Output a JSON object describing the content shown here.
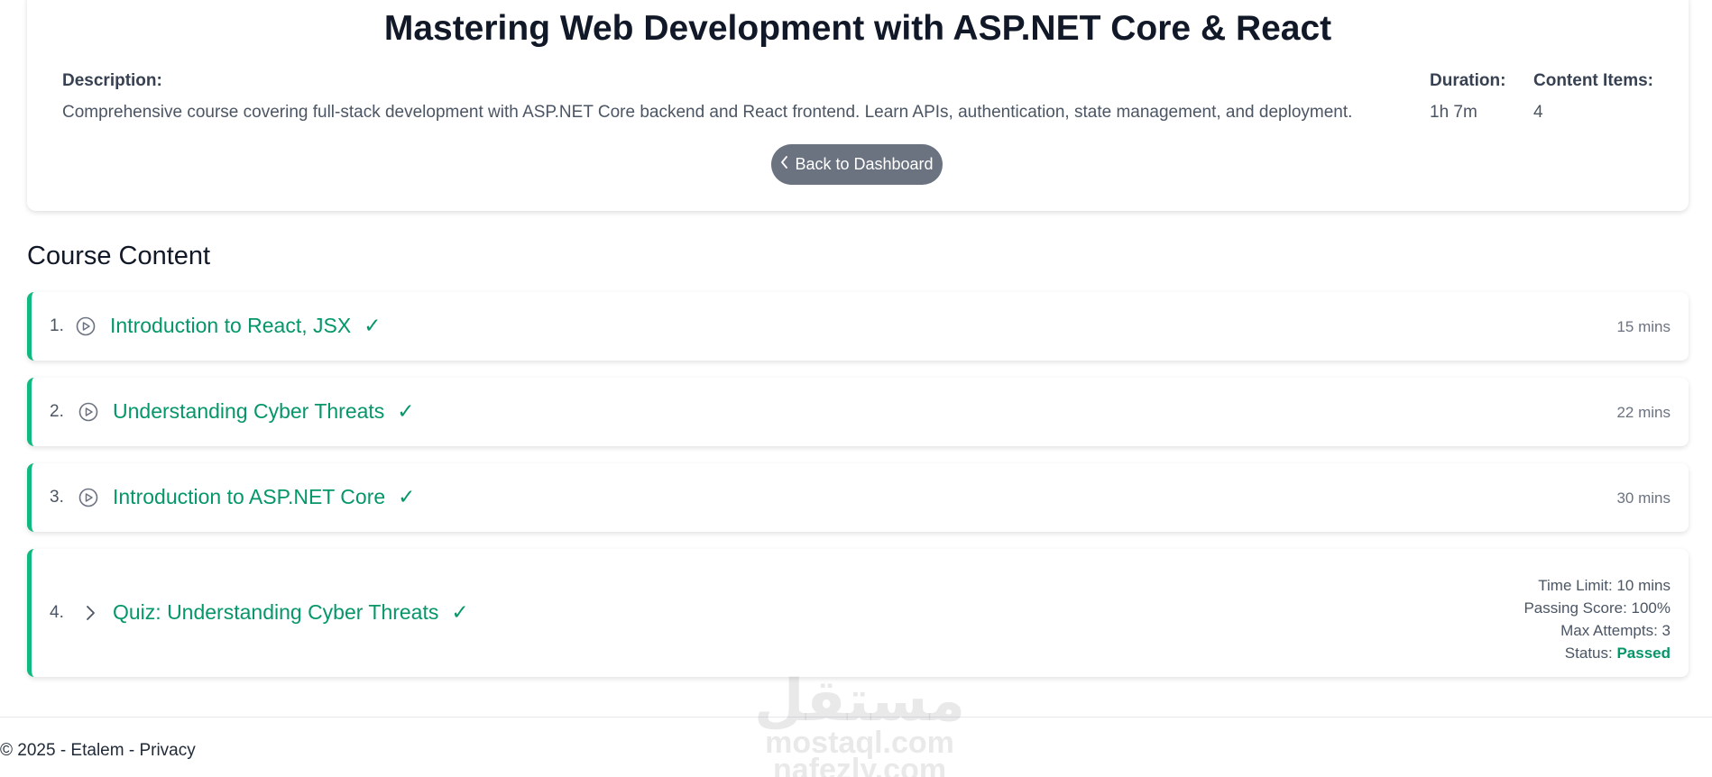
{
  "course": {
    "title": "Mastering Web Development with ASP.NET Core & React",
    "description_label": "Description:",
    "description": "Comprehensive course covering full-stack development with ASP.NET Core backend and React frontend. Learn APIs, authentication, state management, and deployment.",
    "duration_label": "Duration:",
    "duration": "1h 7m",
    "content_items_label": "Content Items:",
    "content_items": "4",
    "back_button": "Back to Dashboard"
  },
  "content": {
    "heading": "Course Content",
    "items": [
      {
        "number": "1.",
        "icon": "play-circle-icon",
        "title": "Introduction to React, JSX",
        "check": "✓",
        "duration": "15 mins"
      },
      {
        "number": "2.",
        "icon": "play-circle-icon",
        "title": "Understanding Cyber Threats",
        "check": "✓",
        "duration": "22 mins"
      },
      {
        "number": "3.",
        "icon": "play-circle-icon",
        "title": "Introduction to ASP.NET Core",
        "check": "✓",
        "duration": "30 mins"
      },
      {
        "number": "4.",
        "icon": "chevron-right-icon",
        "title": "Quiz: Understanding Cyber Threats",
        "check": "✓",
        "time_limit": "Time Limit: 10 mins",
        "passing_score": "Passing Score: 100%",
        "max_attempts": "Max Attempts: 3",
        "status_label": "Status:",
        "status_value": "Passed"
      }
    ]
  },
  "footer": {
    "copyright": "© 2025 - Etalem - ",
    "privacy": "Privacy"
  },
  "watermark": {
    "logo": "مستقل",
    "site1": "mostaql.com",
    "site2": "nafezly.com"
  },
  "colors": {
    "accent": "#10b981",
    "accent_text": "#059669",
    "button": "#6b7280"
  }
}
